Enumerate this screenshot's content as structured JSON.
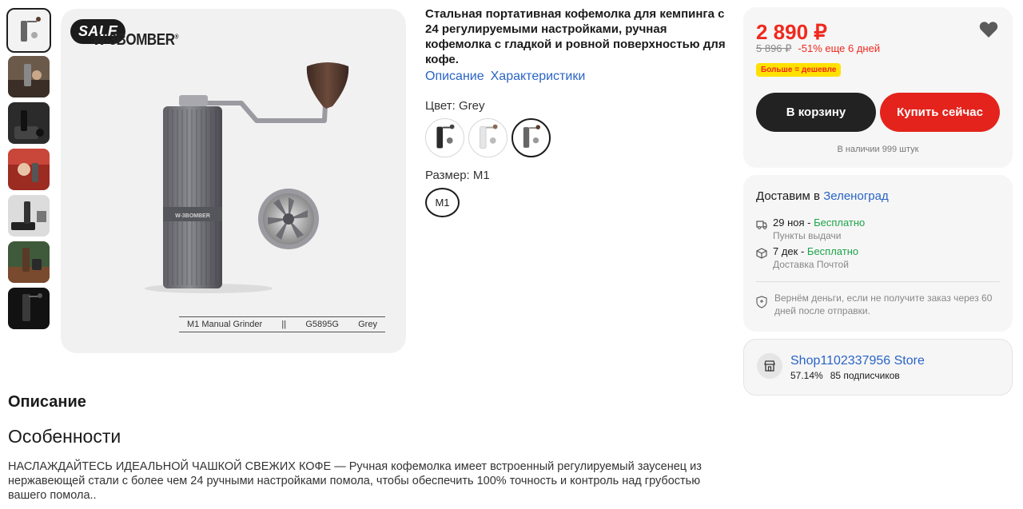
{
  "gallery": {
    "sale_badge": "SALE",
    "brand_text": "W-3BOMBER",
    "brand_mark": "®",
    "caption": [
      "M1 Manual Grinder",
      "||",
      "G5895G",
      "Grey"
    ],
    "thumbnails": [
      "grinder-grey",
      "grinder-hand",
      "grinder-black",
      "grinder-red",
      "grinder-scale",
      "grinder-wood",
      "grinder-night"
    ]
  },
  "product": {
    "title": "Стальная портативная кофемолка для кемпинга с 24 регулируемыми настройками, ручная кофемолка с гладкой и ровной поверхностью для кофе.",
    "links": [
      "Описание",
      "Характеристики"
    ],
    "color_label": "Цвет: Grey",
    "size_label": "Размер: M1",
    "size_value": "M1"
  },
  "price_card": {
    "price": "2 890 ₽",
    "old_price": "5 896 ₽",
    "discount": "-51% еще 6 дней",
    "promo": "Больше = дешевле",
    "cart_button": "В корзину",
    "buy_button": "Купить сейчас",
    "stock": "В наличии 999 штук"
  },
  "delivery": {
    "title_prefix": "Доставим в",
    "city": "Зеленоград",
    "options": [
      {
        "date": "29 ноя",
        "sep": " - ",
        "price": "Бесплатно",
        "method": "Пункты выдачи",
        "icon": "pickup-icon"
      },
      {
        "date": "7 дек",
        "sep": " - ",
        "price": "Бесплатно",
        "method": "Доставка Почтой",
        "icon": "box-icon"
      }
    ],
    "guarantee": "Вернём деньги, если не получите заказ через 60 дней после отправки."
  },
  "store": {
    "name": "Shop1102337956 Store",
    "rating": "57.14%",
    "subscribers": "85 подписчиков"
  },
  "description": {
    "heading": "Описание",
    "subheading": "Особенности",
    "text": "НАСЛАЖДАЙТЕСЬ ИДЕАЛЬНОЙ ЧАШКОЙ СВЕЖИХ КОФЕ — Ручная кофемолка имеет встроенный регулируемый заусенец из нержавеющей стали с более чем 24 ручными настройками помола, чтобы обеспечить 100% точность и контроль над грубостью вашего помола.."
  },
  "colors": {
    "price_red": "#f0291e",
    "link_blue": "#2a64c5",
    "free_green": "#1ea34a",
    "buy_red": "#e3231c",
    "cart_dark": "#222222"
  }
}
